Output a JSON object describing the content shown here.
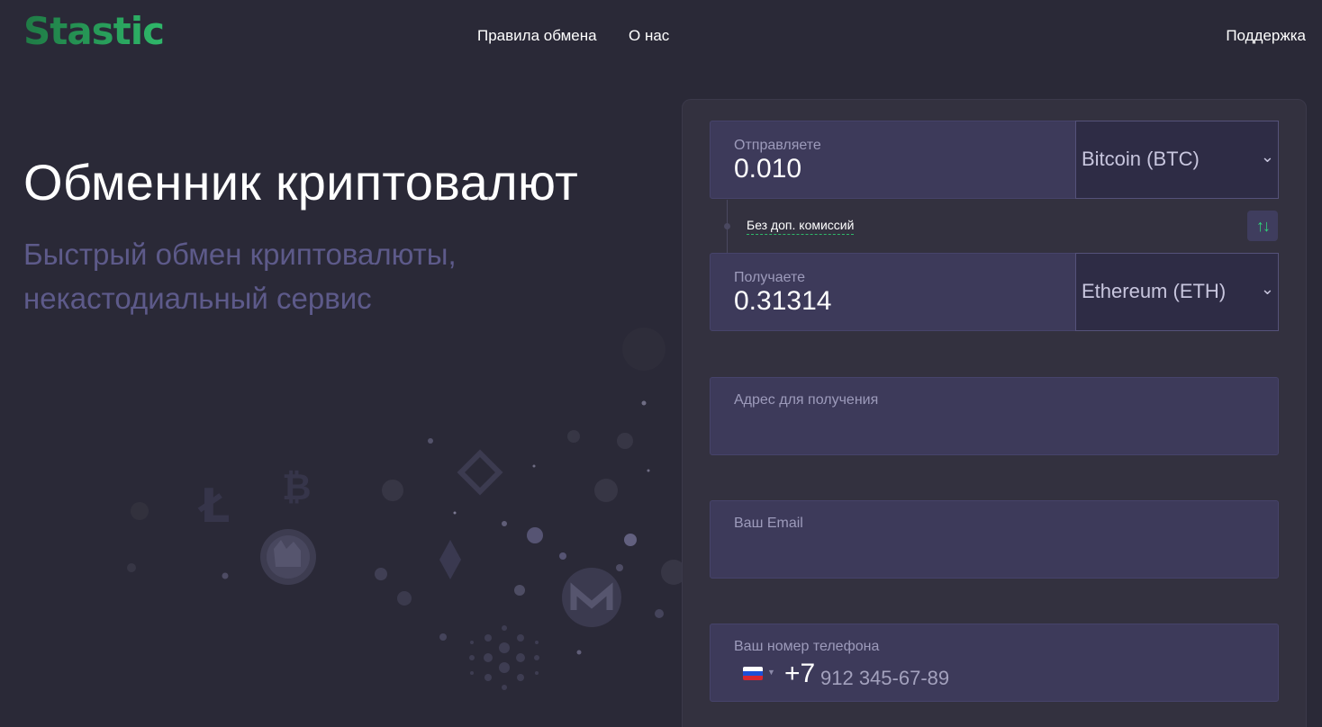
{
  "header": {
    "logo": "Stastic",
    "nav": {
      "rules": "Правила обмена",
      "about": "О нас",
      "support": "Поддержка"
    }
  },
  "hero": {
    "title": "Обменник криптовалют",
    "subtitle": "Быстрый обмен криптовалюты, некастодиальный сервис"
  },
  "exchange": {
    "send": {
      "label": "Отправляете",
      "amount": "0.010",
      "currency": "Bitcoin (BTC)"
    },
    "fee_note": "Без доп. комиссий",
    "receive": {
      "label": "Получаете",
      "amount": "0.31314",
      "currency": "Ethereum (ETH)"
    },
    "address": {
      "label": "Адрес для получения",
      "value": ""
    },
    "email": {
      "label": "Ваш Email",
      "value": ""
    },
    "phone": {
      "label": "Ваш номер телефона",
      "country_code": "+7",
      "placeholder": "912 345-67-89",
      "country": "RU"
    }
  },
  "colors": {
    "background": "#2a2937",
    "panel": "#33313f",
    "field": "#3d3a5a",
    "accent_green": "#2fb86a",
    "subtitle": "#5d5a8a"
  },
  "icons": {
    "chevron": "chevron-down-icon",
    "swap": "swap-arrows-icon",
    "flag": "russia-flag-icon"
  }
}
